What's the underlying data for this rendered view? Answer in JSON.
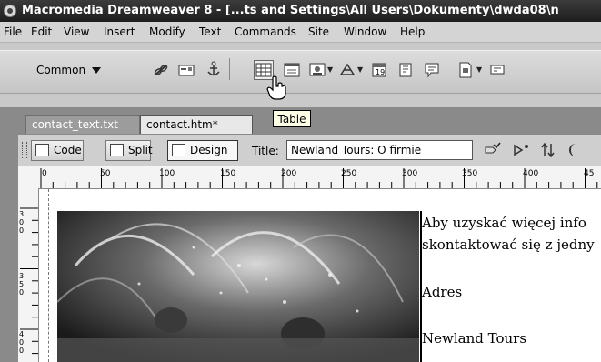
{
  "window": {
    "title": "Macromedia Dreamweaver 8 - [...ts and Settings\\All Users\\Dokumenty\\dwda08\\n"
  },
  "menu": [
    "File",
    "Edit",
    "View",
    "Insert",
    "Modify",
    "Text",
    "Commands",
    "Site",
    "Window",
    "Help"
  ],
  "insert_bar": {
    "category": "Common",
    "icons": [
      "hyperlink-icon",
      "email-link-icon",
      "named-anchor-icon",
      "table-icon",
      "layer-icon",
      "image-icon",
      "media-icon",
      "date-icon",
      "server-side-include-icon",
      "comment-icon",
      "templates-icon",
      "tag-chooser-icon"
    ],
    "tooltip": "Table"
  },
  "documents": {
    "tabs": [
      "contact_text.txt",
      "contact.htm*"
    ],
    "active_tab": 1
  },
  "doc_toolbar": {
    "code": "Code",
    "split": "Split",
    "design": "Design",
    "title_label": "Title:",
    "title_value": "Newland Tours: O firmie"
  },
  "ruler": {
    "horizontal": [
      "0",
      "50",
      "100",
      "150",
      "200",
      "250",
      "300",
      "350",
      "400",
      "45"
    ],
    "vertical": [
      "300",
      "350",
      "400"
    ]
  },
  "content": {
    "para1_line1": "Aby uzyskać więcej info",
    "para1_line2": "skontaktować się z jedny",
    "address_heading": "Adres",
    "company": "Newland Tours"
  },
  "colors": {
    "titlebar": "#2a2a2a",
    "chrome": "#d4d4d4",
    "workspace": "#8a8a8a"
  }
}
